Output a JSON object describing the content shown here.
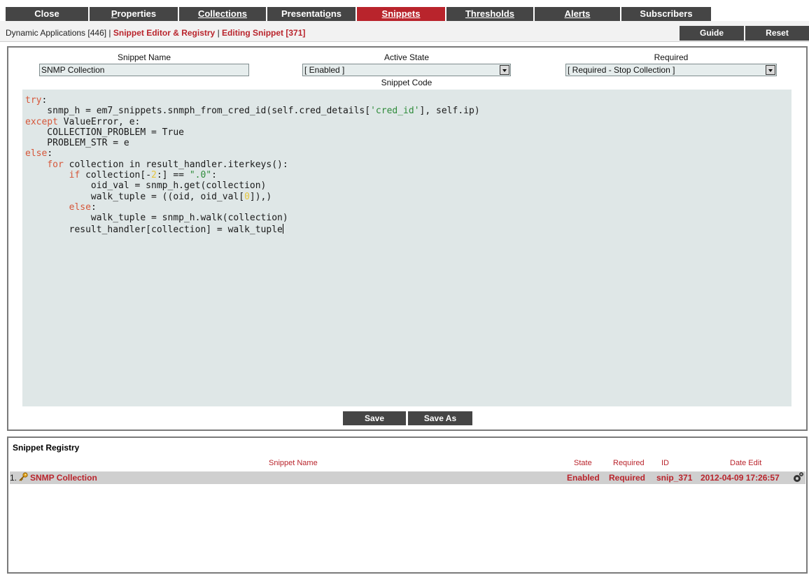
{
  "tabs": [
    {
      "label": "Close",
      "u": ""
    },
    {
      "label_pre": "",
      "u": "P",
      "label_post": "roperties"
    },
    {
      "label_pre": "",
      "u": "C",
      "label_post": "ollections"
    },
    {
      "label_pre": "Presentati",
      "u": "o",
      "label_post": "ns"
    },
    {
      "label_pre": "",
      "u": "S",
      "label_post": "nippets"
    },
    {
      "label_pre": "",
      "u": "T",
      "label_post": "hresholds"
    },
    {
      "label_pre": "",
      "u": "A",
      "label_post": "lerts"
    },
    {
      "label": "Subscribers",
      "u": ""
    }
  ],
  "active_tab": "Snippets",
  "breadcrumb": {
    "root": "Dynamic Applications [446] | ",
    "section": "Snippet Editor & Registry",
    "sep": " | ",
    "current": "Editing Snippet [371]"
  },
  "header_buttons": {
    "guide": "Guide",
    "reset": "Reset"
  },
  "form": {
    "snippet_name_label": "Snippet Name",
    "snippet_name_value": "SNMP Collection",
    "active_state_label": "Active State",
    "active_state_value": "[ Enabled ]",
    "required_label": "Required",
    "required_value": "[ Required - Stop Collection ]",
    "snippet_code_label": "Snippet Code"
  },
  "code_lines": [
    [
      {
        "t": "try",
        "c": "kw"
      },
      {
        "t": ":"
      }
    ],
    [
      {
        "t": "    snmp_h = em7_snippets.snmph_from_cred_id(self.cred_details["
      },
      {
        "t": "'cred_id'",
        "c": "str"
      },
      {
        "t": "], self.ip)"
      }
    ],
    [
      {
        "t": "except",
        "c": "kw"
      },
      {
        "t": " ValueError, e:"
      }
    ],
    [
      {
        "t": "    COLLECTION_PROBLEM = True"
      }
    ],
    [
      {
        "t": "    PROBLEM_STR = e"
      }
    ],
    [
      {
        "t": "else",
        "c": "kw"
      },
      {
        "t": ":"
      }
    ],
    [
      {
        "t": "    "
      },
      {
        "t": "for",
        "c": "kw"
      },
      {
        "t": " collection in result_handler.iterkeys():"
      }
    ],
    [
      {
        "t": "        "
      },
      {
        "t": "if",
        "c": "kw"
      },
      {
        "t": " collection[-"
      },
      {
        "t": "2",
        "c": "num"
      },
      {
        "t": ":] == "
      },
      {
        "t": "\".0\"",
        "c": "str"
      },
      {
        "t": ":"
      }
    ],
    [
      {
        "t": "            oid_val = snmp_h.get(collection)"
      }
    ],
    [
      {
        "t": "            walk_tuple = ((oid, oid_val["
      },
      {
        "t": "0",
        "c": "num"
      },
      {
        "t": "]),)"
      }
    ],
    [
      {
        "t": "        "
      },
      {
        "t": "else",
        "c": "kw"
      },
      {
        "t": ":"
      }
    ],
    [
      {
        "t": "            walk_tuple = snmp_h.walk(collection)"
      }
    ],
    [
      {
        "t": "        result_handler[collection] = walk_tuple"
      }
    ]
  ],
  "buttons": {
    "save": "Save",
    "save_as": "Save As"
  },
  "registry": {
    "title": "Snippet Registry",
    "columns": {
      "name": "Snippet Name",
      "state": "State",
      "required": "Required",
      "id": "ID",
      "date": "Date Edit"
    },
    "rows": [
      {
        "index": "1.",
        "name": "SNMP Collection",
        "state": "Enabled",
        "required": "Required",
        "id": "snip_371",
        "date": "2012-04-09 17:26:57"
      }
    ]
  },
  "icons": {
    "row_icon": "key-icon",
    "row_action": "gear-icon"
  },
  "colors": {
    "accent": "#b9242c",
    "tab_bg": "#454545",
    "code_bg": "#dfe7e7",
    "keyword": "#d6573a",
    "string": "#2e8b3a"
  }
}
